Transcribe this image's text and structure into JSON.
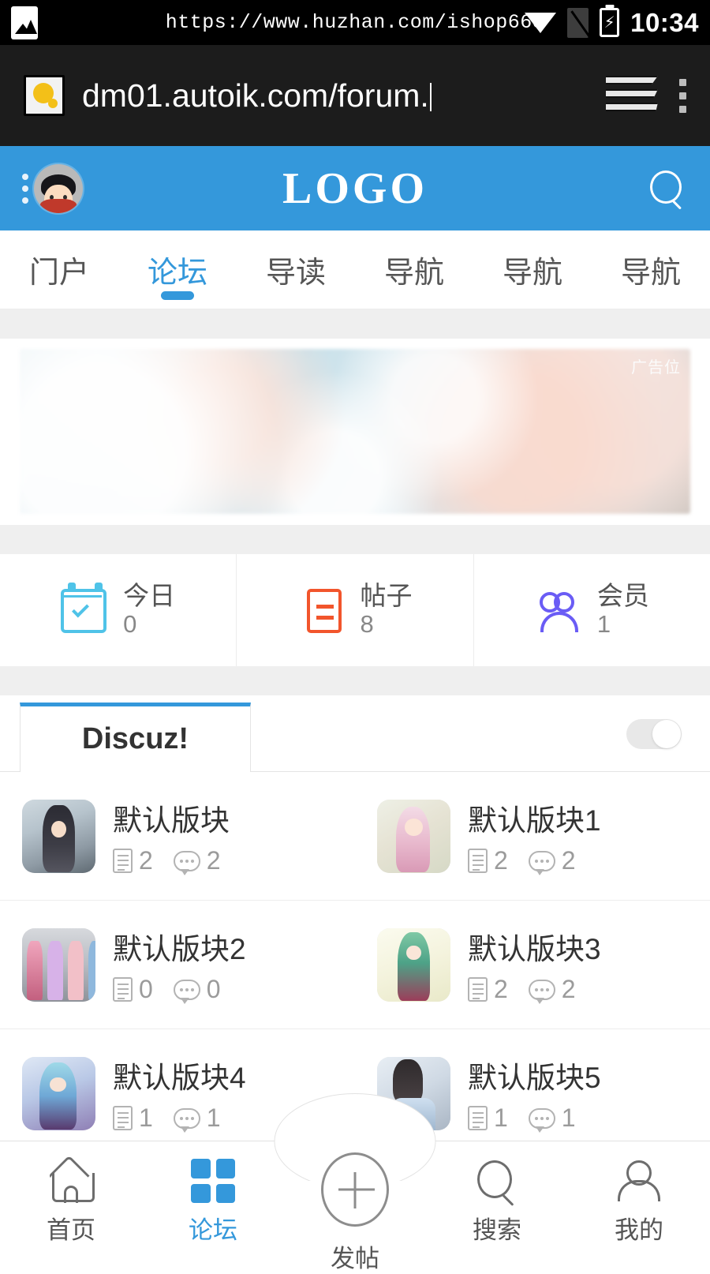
{
  "status_bar": {
    "url_text": "https://www.huzhan.com/ishop663",
    "time": "10:34",
    "icons": [
      "photo-icon",
      "wifi-icon",
      "signal-off-icon",
      "battery-charging-icon"
    ]
  },
  "browser": {
    "url": "dm01.autoik.com/forum.",
    "favicon": "page-icon",
    "tabs_icon": "tabs-stack-icon",
    "menu_icon": "overflow-menu-icon"
  },
  "app_header": {
    "logo": "LOGO",
    "menu_icon": "three-dots-icon",
    "avatar_icon": "user-avatar",
    "search_icon": "search-icon",
    "bg_color": "#3498db"
  },
  "nav_tabs": {
    "items": [
      {
        "label": "门户",
        "active": false
      },
      {
        "label": "论坛",
        "active": true
      },
      {
        "label": "导读",
        "active": false
      },
      {
        "label": "导航",
        "active": false
      },
      {
        "label": "导航",
        "active": false
      },
      {
        "label": "导航",
        "active": false
      }
    ],
    "active_color": "#3498db"
  },
  "banner": {
    "tag": "广告位"
  },
  "stats": [
    {
      "label": "今日",
      "value": "0",
      "icon": "calendar-check-icon",
      "color": "#4fc3e8"
    },
    {
      "label": "帖子",
      "value": "8",
      "icon": "document-icon",
      "color": "#f2552c"
    },
    {
      "label": "会员",
      "value": "1",
      "icon": "users-icon",
      "color": "#6a5cf5"
    }
  ],
  "section": {
    "tab_label": "Discuz!",
    "toggle_state": "on",
    "accent_color": "#3498db"
  },
  "forums": [
    {
      "name": "默认版块",
      "threads": "2",
      "replies": "2",
      "art": "a0"
    },
    {
      "name": "默认版块1",
      "threads": "2",
      "replies": "2",
      "art": "a1"
    },
    {
      "name": "默认版块2",
      "threads": "0",
      "replies": "0",
      "art": "a2"
    },
    {
      "name": "默认版块3",
      "threads": "2",
      "replies": "2",
      "art": "a3"
    },
    {
      "name": "默认版块4",
      "threads": "1",
      "replies": "1",
      "art": "a4"
    },
    {
      "name": "默认版块5",
      "threads": "1",
      "replies": "1",
      "art": "a5"
    }
  ],
  "bottom_nav": {
    "items": [
      {
        "label": "首页",
        "icon": "home-icon",
        "active": false
      },
      {
        "label": "论坛",
        "icon": "grid-icon",
        "active": true
      },
      {
        "label": "发帖",
        "icon": "plus-circle-icon",
        "active": false
      },
      {
        "label": "搜索",
        "icon": "search-icon",
        "active": false
      },
      {
        "label": "我的",
        "icon": "person-icon",
        "active": false
      }
    ],
    "active_color": "#3498db"
  }
}
